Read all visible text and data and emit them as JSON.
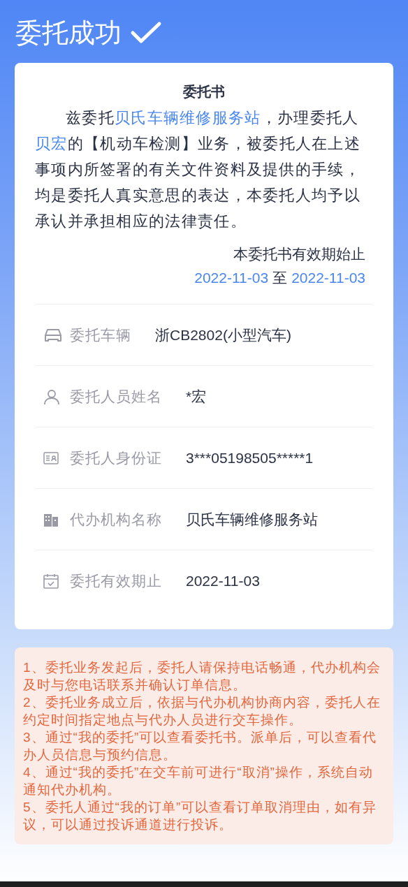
{
  "header": {
    "title": "委托成功"
  },
  "letter": {
    "title": "委托书",
    "body": [
      {
        "kind": "plain",
        "text": "兹委托"
      },
      {
        "kind": "highlight",
        "text": "贝氏车辆维修服务站"
      },
      {
        "kind": "plain",
        "text": "，办理委托人"
      },
      {
        "kind": "highlight",
        "text": "贝宏"
      },
      {
        "kind": "plain",
        "text": "的【机动车检测】业务，被委托人在上述事项内所签署的有关文件资料及提供的手续，均是委托人真实意思的表达，本委托人均予以承认并承担相应的法律责任。"
      }
    ],
    "validity_label": "本委托书有效期始止",
    "start_date": "2022-11-03",
    "date_separator": "至",
    "end_date": "2022-11-03"
  },
  "details": [
    {
      "kind": "car",
      "label": "委托车辆",
      "value": "浙CB2802(小型汽车)"
    },
    {
      "kind": "person",
      "label": "委托人员姓名",
      "value": "*宏"
    },
    {
      "kind": "id",
      "label": "委托人身份证",
      "value": "3***05198505*****1"
    },
    {
      "kind": "building",
      "label": "代办机构名称",
      "value": "贝氏车辆维修服务站"
    },
    {
      "kind": "calendar",
      "label": "委托有效期止",
      "value": "2022-11-03"
    }
  ],
  "notes": [
    "1、委托业务发起后，委托人请保持电话畅通，代办机构会及时与您电话联系并确认订单信息。",
    "2、委托业务成立后，依据与代办机构协商内容，委托人在约定时间指定地点与代办人员进行交车操作。",
    "3、通过“我的委托”可以查看委托书。派单后，可以查看代办人员信息与预约信息。",
    "4、通过“我的委托”在交车前可进行“取消”操作，系统自动通知代办机构。",
    "5、委托人通过“我的订单”可以查看订单取消理由，如有异议，可以通过投诉通道进行投诉。"
  ]
}
